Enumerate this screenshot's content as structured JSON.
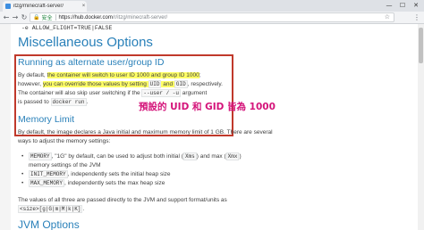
{
  "browser": {
    "tab_title": "itzg/minecraft-server/",
    "tab_close": "×",
    "window_controls": [
      "—",
      "☐",
      "✕"
    ],
    "nav": {
      "back": "←",
      "forward": "→",
      "reload": "↻"
    },
    "address": {
      "lock": "🔒",
      "secure_label": "安全",
      "host": "https://hub.docker.com",
      "path": "/r/itzg/minecraft-server/"
    },
    "bookmark_star": "☆",
    "menu": "⋮"
  },
  "page": {
    "env_line": "-e ALLOW_FLIGHT=TRUE|FALSE",
    "misc_heading": "Miscellaneous Options",
    "user_section": {
      "heading": "Running as alternate user/group ID",
      "line1_a": "By default, ",
      "line1_b": "the container will switch to user ID 1000 and group ID 1000",
      "line1_c": ";",
      "line2_a": "however, ",
      "line2_b": "you can override those values by setting ",
      "line2_uid": "UID",
      "line2_and": " and ",
      "line2_gid": "GID",
      "line2_c": ", respectively.",
      "line3_a": "The container will also skip user switching if the ",
      "line3_code": "--user / -u",
      "line3_b": " argument",
      "line4_a": "is passed to ",
      "line4_code": "docker run",
      "line4_b": "."
    },
    "annotation": "預設的 UID 和 GID 皆為 1000",
    "memory_section": {
      "heading": "Memory Limit",
      "para1": "By default, the image declares a Java initial and maximum memory limit of 1 GB. There are several",
      "para2": "ways to adjust the memory settings:",
      "bullets": [
        {
          "code": "MEMORY",
          "text1": ", \"1G\" by default, can be used to adjust both initial (",
          "code2": "Xms",
          "text2": ") and max (",
          "code3": "Xmx",
          "text3": ")",
          "cont": "memory settings of the JVM"
        },
        {
          "code": "INIT_MEMORY",
          "text1": ", independently sets the initial heap size"
        },
        {
          "code": "MAX_MEMORY",
          "text1": ", independently sets the max heap size"
        }
      ],
      "para3": "The values of all three are passed directly to the JVM and support format/units as",
      "units_code": "<size>[g|G|m|M|k|K]",
      "units_tail": "."
    },
    "jvm_heading": "JVM Options"
  }
}
